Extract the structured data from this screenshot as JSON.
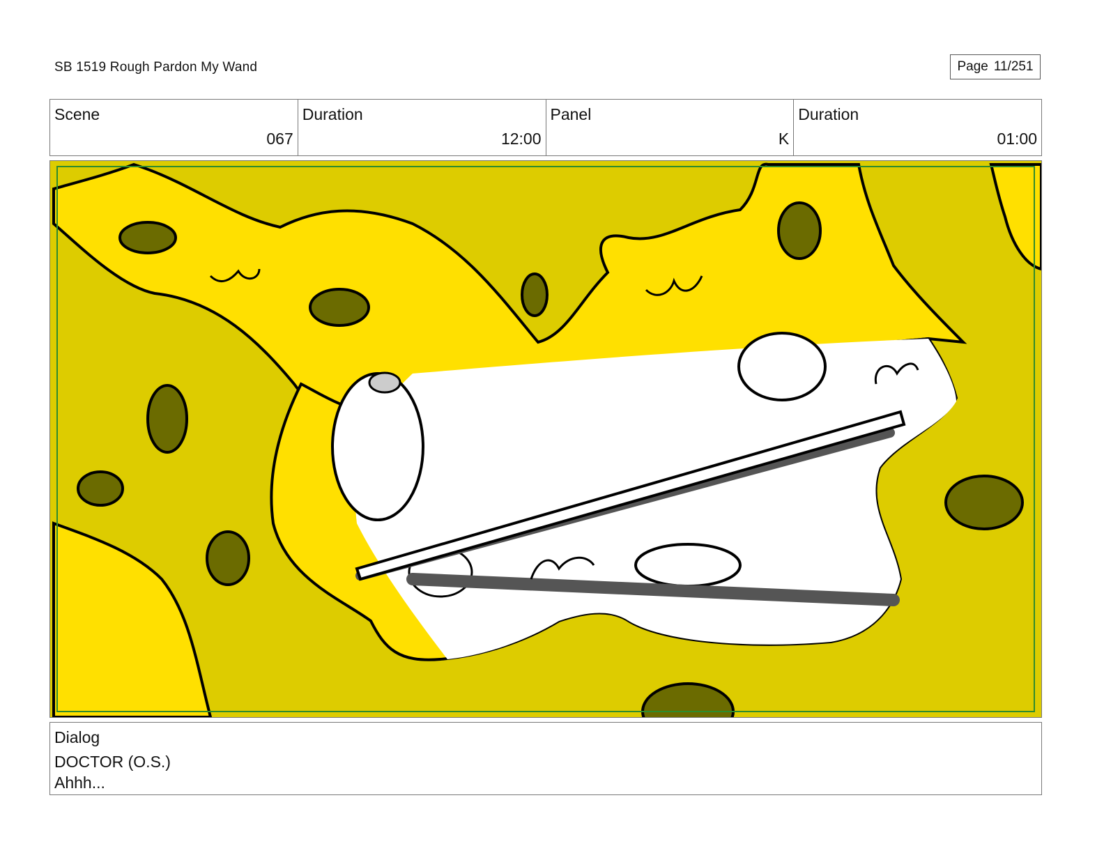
{
  "header": {
    "title": "SB 1519 Rough  Pardon My Wand",
    "page_label": "Page",
    "page_number": "11/251"
  },
  "info": {
    "scene_label": "Scene",
    "scene_value": "067",
    "scene_duration_label": "Duration",
    "scene_duration_value": "12:00",
    "panel_label": "Panel",
    "panel_value": "K",
    "panel_duration_label": "Duration",
    "panel_duration_value": "01:00"
  },
  "colors": {
    "background_yellow": "#ddcc00",
    "bright_yellow": "#ffe000",
    "hole_olive": "#6b6b00",
    "outline": "#000000",
    "shadow_gray": "#555555",
    "safe_frame_green": "#2e8b2e"
  },
  "dialog": {
    "label": "Dialog",
    "character": "DOCTOR (O.S.)",
    "line": "Ahhh..."
  }
}
